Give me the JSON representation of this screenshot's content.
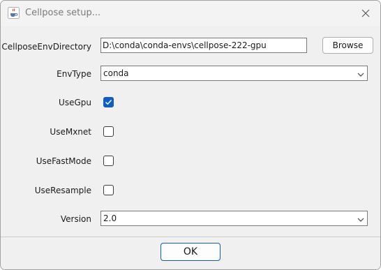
{
  "window": {
    "title": "Cellpose setup..."
  },
  "form": {
    "env_directory": {
      "label": "CellposeEnvDirectory",
      "value": "D:\\conda\\conda-envs\\cellpose-222-gpu",
      "browse_label": "Browse"
    },
    "env_type": {
      "label": "EnvType",
      "selected": "conda"
    },
    "use_gpu": {
      "label": "UseGpu",
      "checked": true
    },
    "use_mxnet": {
      "label": "UseMxnet",
      "checked": false
    },
    "use_fast_mode": {
      "label": "UseFastMode",
      "checked": false
    },
    "use_resample": {
      "label": "UseResample",
      "checked": false
    },
    "version": {
      "label": "Version",
      "selected": "2.0"
    }
  },
  "footer": {
    "ok_label": "OK"
  },
  "colors": {
    "accent": "#0f5cc4",
    "window_bg": "#f0f0f0"
  },
  "icons": {
    "app": "java-cup-icon",
    "close": "close-icon",
    "dropdown": "chevron-down-icon",
    "check": "checkmark-icon"
  }
}
